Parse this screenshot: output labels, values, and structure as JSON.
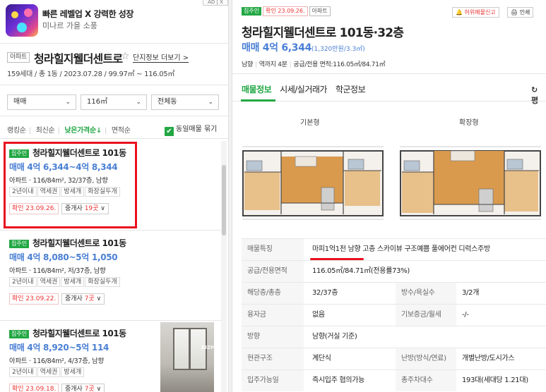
{
  "ad": {
    "title": "빠른 레벨업 X 강력한 성장",
    "subtitle": "미나르 가을 소풍",
    "ad_label": "AD | X"
  },
  "complex": {
    "type_badge": "아파트",
    "name": "청라힐지웰더센트로",
    "star": "☆",
    "more_link": "단지정보 더보기 >",
    "info": "159세대 / 총 1동 / 2023.07.28 / 99.97㎡ ~ 116.05㎡"
  },
  "filters": {
    "trade": "매매",
    "area": "116㎡",
    "dong": "전체동"
  },
  "sorts": {
    "items": [
      "랭킹순",
      "최신순",
      "낮은가격순↓",
      "면적순"
    ],
    "same_listing_label": "동일매물 묶기",
    "same_listing_check": "✔"
  },
  "listings": [
    {
      "tag": "집주인",
      "name": "청라힐지웰더센트로 101동",
      "price": "매매 4억 6,344~4억 8,344",
      "desc": "아파트 · 116/84m², 32/37층, 남향",
      "tags": [
        "2년이내",
        "역세권",
        "방세개",
        "화장실두개"
      ],
      "confirmed": "확인 23.09.26.",
      "agent_prefix": "중개사 ",
      "agent_count": "19곳",
      "agent_suffix": " ∨"
    },
    {
      "tag": "집주인",
      "name": "청라힐지웰더센트로 101동",
      "price": "매매 4억 8,080~5억 1,050",
      "desc": "아파트 · 116/84m², 저/37층, 남향",
      "tags": [
        "2년이내",
        "역세권",
        "방세개",
        "화장실두개"
      ],
      "confirmed": "확인 23.09.22.",
      "agent_prefix": "중개사 ",
      "agent_count": "7곳",
      "agent_suffix": " ∨"
    },
    {
      "tag": "집주인",
      "name": "청라힐지웰더센트로 101동",
      "price": "매매 4억 8,920~5억 114",
      "desc": "아파트 · 116/84m², 4/37층, 남향",
      "tags": [
        "2년이내",
        "역세권",
        "방세개"
      ],
      "confirmed": "확인 23.09.18.",
      "agent_prefix": "중개사 ",
      "agent_count": "7곳",
      "agent_suffix": " ∨",
      "photo_watermark": "BIZMI"
    }
  ],
  "detail": {
    "badges": [
      "집주인",
      "확인 23.09.26.",
      "아파트"
    ],
    "report": "🔔 허위매물신고",
    "print": "🖨 인쇄",
    "title": "청라힐지웰더센트로 101동·32층",
    "price": "매매 4억 6,344",
    "unit_price": "(1,320만원/3.3㎡)",
    "meta": [
      "남향",
      "역까지 4분",
      "공급/전용 면적:116.05㎡/84.71㎡"
    ],
    "tabs": [
      "매물정보",
      "시세/실거래가",
      "학군정보"
    ],
    "pyeong": "↻ 평",
    "floorplan_basic": "기본형",
    "floorplan_ext": "확장형",
    "rows": [
      {
        "k": "매물특징",
        "v": "마피1억1천 남향 고층 스카이뷰 구조예쁨 풀에어컨 디럭스주방"
      },
      {
        "k": "공급/전용면적",
        "v": "116.05㎡/84.71㎡(전용률73%)"
      },
      {
        "k": "해당층/총층",
        "v": "32/37층",
        "k2": "방수/욕실수",
        "v2": "3/2개"
      },
      {
        "k": "융자금",
        "v": "없음",
        "k2": "기보증금/월세",
        "v2": "-/-"
      },
      {
        "k": "방향",
        "v": "남향(거실 기준)"
      },
      {
        "k": "현관구조",
        "v": "계단식",
        "k2": "난방(방식/연료)",
        "v2": "개별난방/도시가스"
      },
      {
        "k": "입주가능일",
        "v": "즉시입주 협의가능",
        "k2": "총주차대수",
        "v2": "193대(세대당 1.21대)"
      }
    ]
  },
  "colors": {
    "accent_green": "#22a744",
    "price_blue": "#4a7fd4",
    "highlight_red": "#e8101e"
  }
}
